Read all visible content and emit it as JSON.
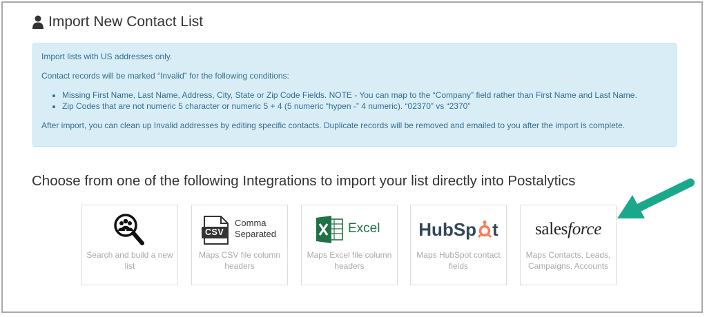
{
  "page": {
    "title": "Import New Contact List",
    "icon": "user-icon"
  },
  "notice": {
    "line1": "Import lists with US addresses only.",
    "line2": "Contact records will be marked “Invalid” for the following conditions:",
    "bullets": [
      "Missing First Name, Last Name, Address, City, State or Zip Code Fields. NOTE - You can map to the “Company” field rather than First Name and Last Name.",
      "Zip Codes that are not numeric 5 character or numeric 5 + 4 (5 numeric “hypen -” 4 numeric). “02370” vs “2370”"
    ],
    "line3": "After import, you can clean up Invalid addresses by editing specific contacts. Duplicate records will be removed and emailed to you after the import is complete."
  },
  "integrations": {
    "heading": "Choose from one of the following Integrations to import your list directly into Postalytics",
    "cards": [
      {
        "name": "search",
        "icon": "search-people-icon",
        "desc": "Search and build a new list"
      },
      {
        "name": "csv",
        "logo_badge": "CSV",
        "logo_line1": "Comma",
        "logo_line2": "Separated",
        "desc": "Maps CSV file column headers"
      },
      {
        "name": "excel",
        "logo_text": "Excel",
        "desc": "Maps Excel file column headers"
      },
      {
        "name": "hubspot",
        "logo_text_a": "HubSp",
        "logo_text_b": "t",
        "desc": "Maps HubSpot contact fields"
      },
      {
        "name": "salesforce",
        "logo_text_a": "sales",
        "logo_text_b": "force",
        "desc": "Maps Contacts, Leads, Campaigns, Accounts"
      }
    ]
  },
  "colors": {
    "alert_bg": "#d9edf7",
    "alert_text": "#31708f",
    "arrow": "#1aa88a",
    "excel_green": "#1f7245",
    "hubspot_dark": "#33475b",
    "hubspot_orange": "#ff7a59"
  }
}
